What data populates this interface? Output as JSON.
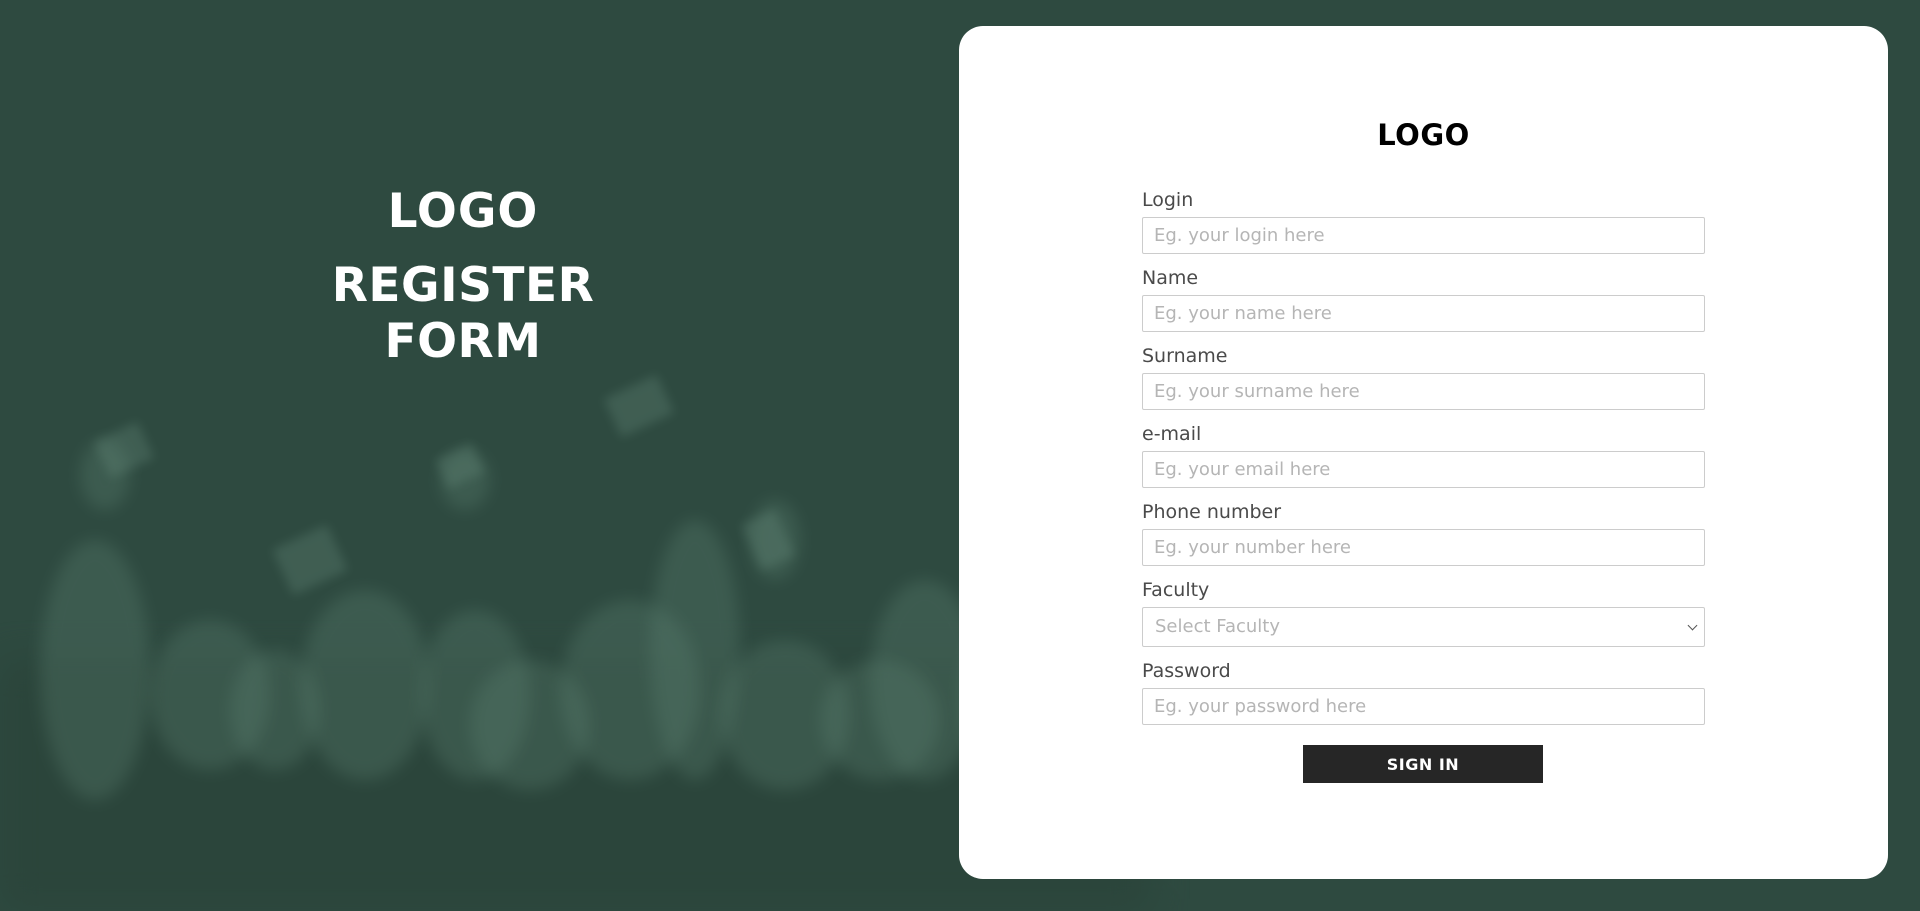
{
  "hero": {
    "logo": "LOGO",
    "title_line1": "REGISTER",
    "title_line2": "FORM"
  },
  "card": {
    "logo": "LOGO",
    "fields": [
      {
        "label": "Login",
        "placeholder": "Eg. your login here"
      },
      {
        "label": "Name",
        "placeholder": "Eg. your name here"
      },
      {
        "label": "Surname",
        "placeholder": "Eg. your surname here"
      },
      {
        "label": "e-mail",
        "placeholder": "Eg. your email here"
      },
      {
        "label": "Phone number",
        "placeholder": "Eg. your number here"
      },
      {
        "label": "Faculty",
        "selected": "Select Faculty"
      },
      {
        "label": "Password",
        "placeholder": "Eg. your password here"
      }
    ],
    "submit_label": "SIGN IN"
  },
  "colors": {
    "background": "#2e4a40",
    "card": "#ffffff",
    "button": "#262626"
  },
  "icons": {
    "select_arrow": "chevron-down-icon"
  }
}
